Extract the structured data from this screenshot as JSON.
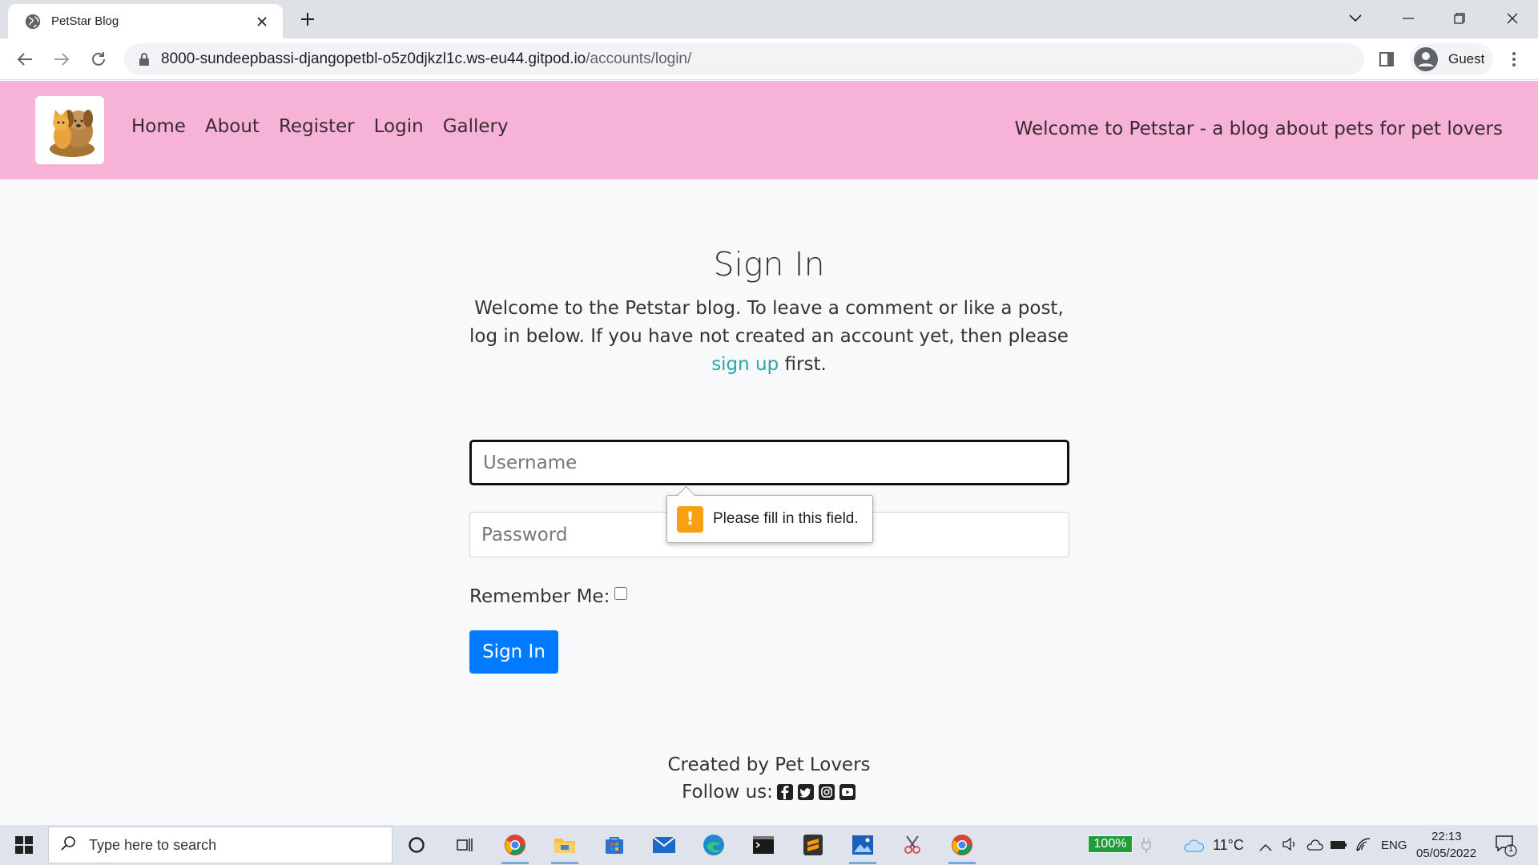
{
  "browser": {
    "tab_title": "PetStar Blog",
    "url_host": "8000-sundeepbassi-djangopetbl-o5z0djkzl1c.ws-eu44.gitpod.io",
    "url_path": "/accounts/login/",
    "profile_label": "Guest"
  },
  "navbar": {
    "links": [
      "Home",
      "About",
      "Register",
      "Login",
      "Gallery"
    ],
    "tagline": "Welcome to Petstar - a blog about pets for pet lovers",
    "background": "#f7b2d8"
  },
  "signin": {
    "title": "Sign In",
    "intro_text": "Welcome to the Petstar blog. To leave a comment or like a post, log in below. If you have not created an account yet, then please",
    "signup_link": "sign up",
    "intro_suffix": "first.",
    "username_placeholder": "Username",
    "password_placeholder": "Password",
    "validation_message": "Please fill in this field.",
    "remember_label": "Remember Me:",
    "submit_label": "Sign In",
    "accent_color": "#007bff",
    "link_color": "#2aa6a6"
  },
  "footer": {
    "created_by": "Created by Pet Lovers",
    "follow_label": "Follow us:",
    "social_icons": [
      "facebook-icon",
      "twitter-icon",
      "instagram-icon",
      "youtube-icon"
    ]
  },
  "taskbar": {
    "search_placeholder": "Type here to search",
    "battery": "100%",
    "weather": "11°C",
    "language": "ENG",
    "time": "22:13",
    "date": "05/05/2022",
    "notification_count": "1"
  }
}
